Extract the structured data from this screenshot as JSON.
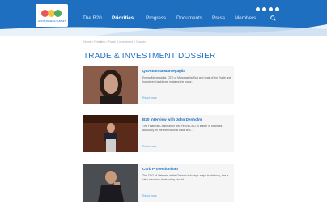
{
  "colors": {
    "brand": "#1f6fc0",
    "link": "#4ea2e0",
    "card_bg": "#f5f5f5"
  },
  "header": {
    "logo_text": "G20 BUSINESS SUMMIT",
    "nav": [
      "The B20",
      "Priorities",
      "Progress",
      "Documents",
      "Press",
      "Members"
    ],
    "active_nav": "Priorities",
    "social_icons": [
      "facebook-icon",
      "twitter-icon",
      "linkedin-icon",
      "youtube-icon"
    ],
    "search_icon": "search-icon"
  },
  "breadcrumb": "Home > Priorities > Trade & Investment > Dossier",
  "title": "TRADE & INVESTMENT DOSSIER",
  "articles": [
    {
      "title": "Q&A Emma Marcegaglia",
      "description": "Emma Marcegaglia, CEO of Marcegaglia SpA and chair of the Trade and Investment taskforce, explains the major...",
      "link": "Read more",
      "thumb_colors": [
        "#7a4b3a",
        "#c89e86",
        "#2b1c16"
      ]
    },
    {
      "title": "B20 Interview with John Denholm",
      "description": "The Financial Chairman of IBM Peru's CEO, is leader of business advocacy on the international trade and...",
      "link": "Read more",
      "thumb_colors": [
        "#5a2b1a",
        "#b96a3a",
        "#2a1208"
      ]
    },
    {
      "title": "Curb Protectionism!",
      "description": "The CEO of Liebherr, at the German industry's major trade body, has a clear idea how trade policy should...",
      "link": "Read more",
      "thumb_colors": [
        "#3a3a3a",
        "#c89a7a",
        "#1a1a20"
      ]
    }
  ]
}
